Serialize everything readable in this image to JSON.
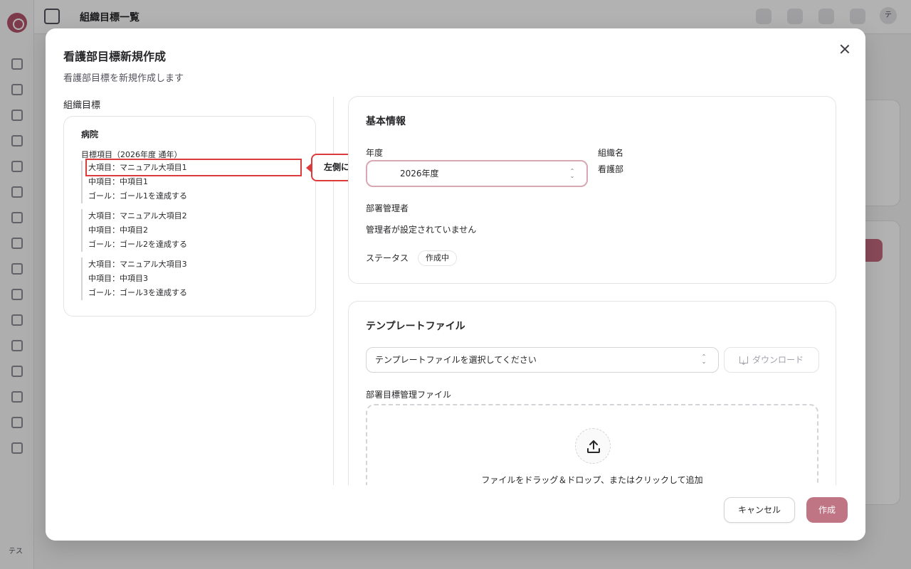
{
  "app": {
    "page_title": "組織目標一覧",
    "user_initials": "テ",
    "bottom_user": "テス"
  },
  "modal": {
    "title": "看護部目標新規作成",
    "description": "看護部目標を新規作成します",
    "left_section_label": "組織目標",
    "org": {
      "name": "病院",
      "goal_header": "目標項目（2026年度 通年）",
      "groups": [
        {
          "major": "大項目：マニュアル大項目1",
          "middle": "中項目：中項目1",
          "goal": "ゴール：ゴール1を達成する"
        },
        {
          "major": "大項目：マニュアル大項目2",
          "middle": "中項目：中項目2",
          "goal": "ゴール：ゴール2を達成する"
        },
        {
          "major": "大項目：マニュアル大項目3",
          "middle": "中項目：中項目3",
          "goal": "ゴール：ゴール3を達成する"
        }
      ]
    },
    "callout": "左側に病院目標",
    "basic_info": {
      "title": "基本情報",
      "year_label": "年度",
      "year_value": "2026年度",
      "org_name_label": "組織名",
      "org_name_value": "看護部",
      "manager_label": "部署管理者",
      "manager_value": "管理者が設定されていません",
      "status_label": "ステータス",
      "status_value": "作成中"
    },
    "template": {
      "title": "テンプレートファイル",
      "select_placeholder": "テンプレートファイルを選択してください",
      "download_label": "ダウンロード",
      "file_label": "部署目標管理ファイル",
      "dropzone_text": "ファイルをドラッグ＆ドロップ、またはクリックして追加"
    },
    "footer": {
      "cancel_label": "キャンセル",
      "create_label": "作成"
    }
  },
  "colors": {
    "accent": "#c07585",
    "highlight": "#dc3b3b"
  }
}
